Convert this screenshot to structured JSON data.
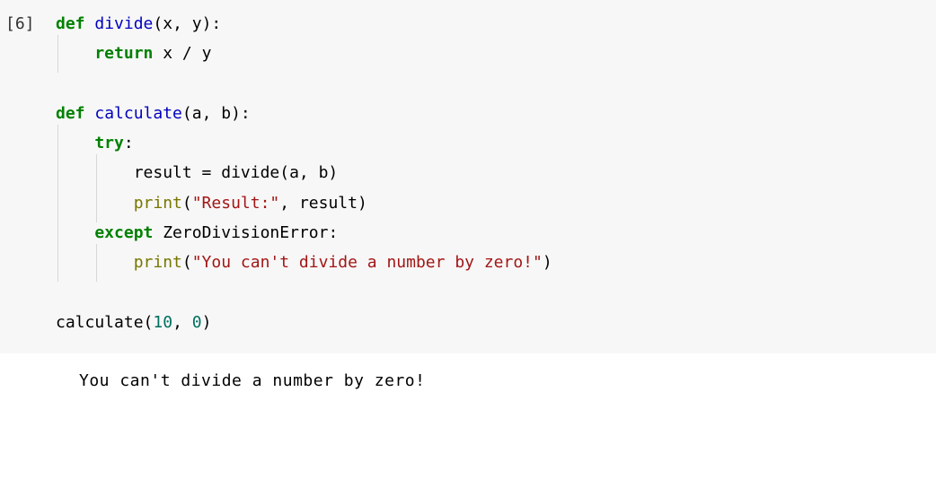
{
  "cell": {
    "prompt": "[6]",
    "code": {
      "tokens": [
        [
          {
            "t": "def ",
            "c": "kw"
          },
          {
            "t": "divide",
            "c": "nf"
          },
          {
            "t": "(x, y):",
            "c": "pun"
          }
        ],
        [
          {
            "t": "    ",
            "g": true
          },
          {
            "t": "return",
            "c": "kw"
          },
          {
            "t": " x ",
            "c": "pun"
          },
          {
            "t": "/",
            "c": "pun"
          },
          {
            "t": " y",
            "c": "pun"
          }
        ],
        [],
        [
          {
            "t": "def ",
            "c": "kw"
          },
          {
            "t": "calculate",
            "c": "nf"
          },
          {
            "t": "(a, b):",
            "c": "pun"
          }
        ],
        [
          {
            "t": "    ",
            "g": true
          },
          {
            "t": "try",
            "c": "kw"
          },
          {
            "t": ":",
            "c": "pun"
          }
        ],
        [
          {
            "t": "    ",
            "g": true
          },
          {
            "t": "    ",
            "g": true
          },
          {
            "t": "result ",
            "c": "pun"
          },
          {
            "t": "=",
            "c": "pun"
          },
          {
            "t": " divide(a, b)",
            "c": "pun"
          }
        ],
        [
          {
            "t": "    ",
            "g": true
          },
          {
            "t": "    ",
            "g": true
          },
          {
            "t": "print",
            "c": "bn"
          },
          {
            "t": "(",
            "c": "pun"
          },
          {
            "t": "\"Result:\"",
            "c": "str"
          },
          {
            "t": ", result)",
            "c": "pun"
          }
        ],
        [
          {
            "t": "    ",
            "g": true
          },
          {
            "t": "except",
            "c": "kw"
          },
          {
            "t": " ",
            "c": "pun"
          },
          {
            "t": "ZeroDivisionError",
            "c": "nc"
          },
          {
            "t": ":",
            "c": "pun"
          }
        ],
        [
          {
            "t": "    ",
            "g": true
          },
          {
            "t": "    ",
            "g": true
          },
          {
            "t": "print",
            "c": "bn"
          },
          {
            "t": "(",
            "c": "pun"
          },
          {
            "t": "\"You can't divide a number by zero!\"",
            "c": "str"
          },
          {
            "t": ")",
            "c": "pun"
          }
        ],
        [],
        [
          {
            "t": "calculate(",
            "c": "pun"
          },
          {
            "t": "10",
            "c": "num"
          },
          {
            "t": ", ",
            "c": "pun"
          },
          {
            "t": "0",
            "c": "num"
          },
          {
            "t": ")",
            "c": "pun"
          }
        ]
      ]
    },
    "output": "You can't divide a number by zero!"
  }
}
